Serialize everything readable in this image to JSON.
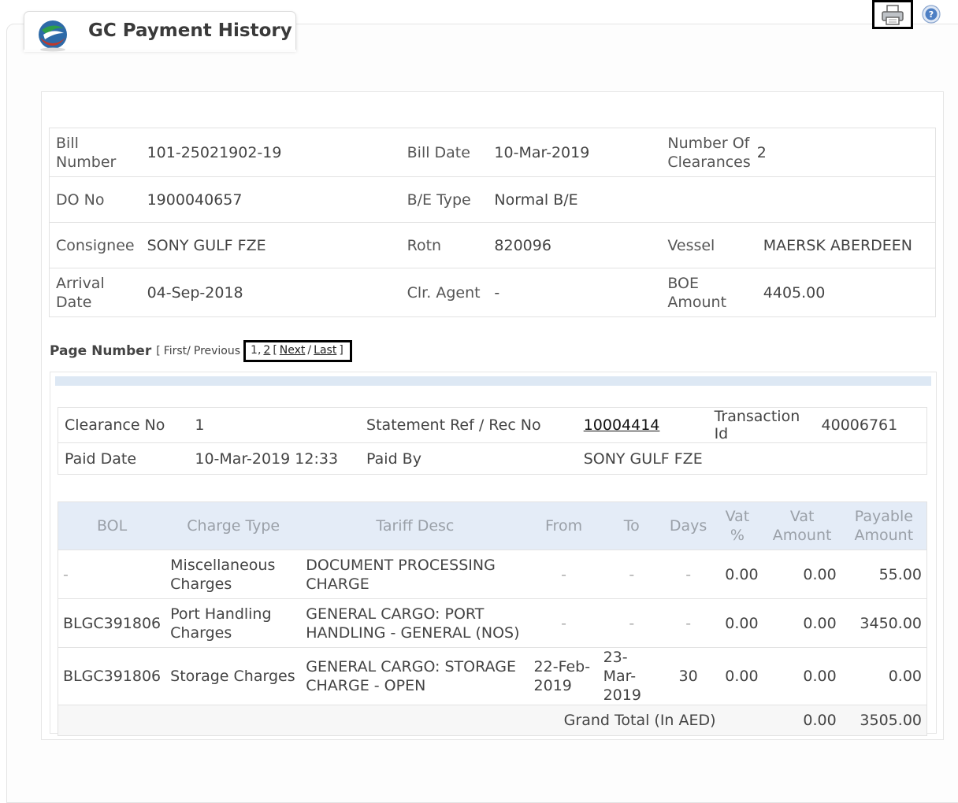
{
  "header": {
    "title": "GC Payment History",
    "print_icon": "printer-icon",
    "help_icon": "help-icon"
  },
  "bill": {
    "bill_number_label": "Bill Number",
    "bill_number": "101-25021902-19",
    "bill_date_label": "Bill Date",
    "bill_date": "10-Mar-2019",
    "num_clearances_label": "Number Of Clearances",
    "num_clearances": "2",
    "do_no_label": "DO No",
    "do_no": "1900040657",
    "be_type_label": "B/E Type",
    "be_type": "Normal B/E",
    "consignee_label": "Consignee",
    "consignee": "SONY GULF FZE",
    "rotn_label": "Rotn",
    "rotn": "820096",
    "vessel_label": "Vessel",
    "vessel": "MAERSK ABERDEEN",
    "arrival_date_label": "Arrival Date",
    "arrival_date": "04-Sep-2018",
    "clr_agent_label": "Clr. Agent",
    "clr_agent": "-",
    "boe_amount_label": "BOE Amount",
    "boe_amount": "4405.00"
  },
  "pager": {
    "label": "Page Number",
    "open": "[",
    "first": "First/",
    "previous": "Previous",
    "page1": "1,",
    "page2": "2",
    "open2": "[",
    "next": "Next",
    "slash": "/",
    "last": "Last",
    "close": "]"
  },
  "clearance": {
    "clearance_no_label": "Clearance No",
    "clearance_no": "1",
    "statement_ref_label": "Statement Ref / Rec No",
    "statement_ref": "10004414",
    "transaction_id_label": "Transaction Id",
    "transaction_id": "40006761",
    "paid_date_label": "Paid Date",
    "paid_date": "10-Mar-2019 12:33",
    "paid_by_label": "Paid By",
    "paid_by": "SONY GULF FZE"
  },
  "charges": {
    "headers": [
      "BOL",
      "Charge Type",
      "Tariff Desc",
      "From",
      "To",
      "Days",
      "Vat %",
      "Vat Amount",
      "Payable Amount"
    ],
    "rows": [
      [
        "-",
        "Miscellaneous Charges",
        "DOCUMENT PROCESSING CHARGE",
        "-",
        "-",
        "-",
        "0.00",
        "0.00",
        "55.00"
      ],
      [
        "BLGC391806",
        "Port Handling Charges",
        "GENERAL CARGO: PORT HANDLING - GENERAL (NOS)",
        "-",
        "-",
        "-",
        "0.00",
        "0.00",
        "3450.00"
      ],
      [
        "BLGC391806",
        "Storage Charges",
        "GENERAL CARGO: STORAGE CHARGE - OPEN",
        "22-Feb-2019",
        "23-Mar-2019",
        "30",
        "0.00",
        "0.00",
        "0.00"
      ]
    ],
    "total_label": "Grand Total (In AED)",
    "total_vat": "0.00",
    "total_payable": "3505.00"
  }
}
